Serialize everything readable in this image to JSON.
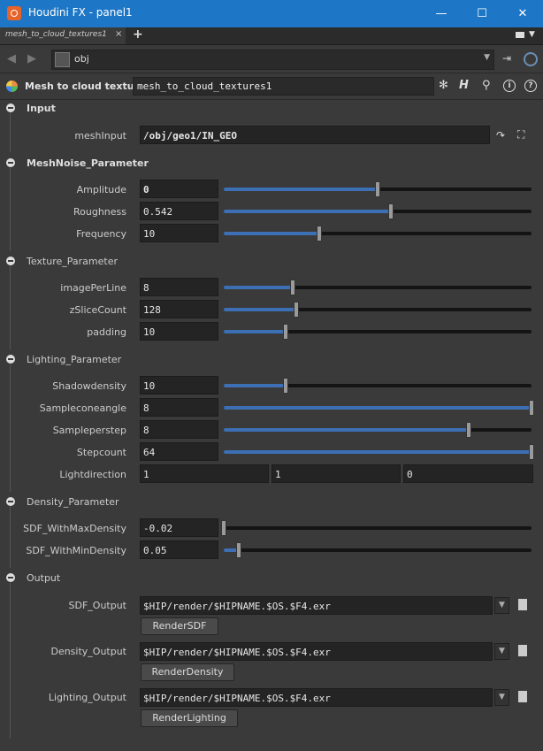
{
  "window": {
    "title": "Houdini FX - panel1",
    "minimize": "—",
    "maximize": "☐",
    "close": "✕"
  },
  "tabs": [
    {
      "label": "mesh_to_cloud_textures1",
      "close": "×"
    }
  ],
  "tab_add": "+",
  "path": {
    "value": "obj"
  },
  "operator": {
    "type_label": "Mesh to cloud textures",
    "name": "mesh_to_cloud_textures1"
  },
  "sections": {
    "input": "Input",
    "mesh_noise": "MeshNoise_Parameter",
    "texture": "Texture_Parameter",
    "lighting": "Lighting_Parameter",
    "density": "Density_Parameter",
    "output": "Output"
  },
  "params": {
    "meshInput": {
      "label": "meshInput",
      "value": "/obj/geo1/IN_GEO"
    },
    "amplitude": {
      "label": "Amplitude",
      "value": "0",
      "level": 0.5
    },
    "roughness": {
      "label": "Roughness",
      "value": "0.542",
      "level": 0.542
    },
    "frequency": {
      "label": "Frequency",
      "value": "10",
      "level": 0.31
    },
    "imagePerLine": {
      "label": "imagePerLine",
      "value": "8",
      "level": 0.225
    },
    "zSliceCount": {
      "label": "zSliceCount",
      "value": "128",
      "level": 0.235
    },
    "padding": {
      "label": "padding",
      "value": "10",
      "level": 0.2
    },
    "shadowdensity": {
      "label": "Shadowdensity",
      "value": "10",
      "level": 0.2
    },
    "sampleconeangle": {
      "label": "Sampleconeangle",
      "value": "8",
      "level": 1.0
    },
    "sampleperstep": {
      "label": "Sampleperstep",
      "value": "8",
      "level": 0.795
    },
    "stepcount": {
      "label": "Stepcount",
      "value": "64",
      "level": 1.0
    },
    "lightdirection": {
      "label": "Lightdirection",
      "values": [
        "1",
        "1",
        "0"
      ]
    },
    "sdfMax": {
      "label": "SDF_WithMaxDensity",
      "value": "-0.02",
      "level": 0.0
    },
    "sdfMin": {
      "label": "SDF_WithMinDensity",
      "value": "0.05",
      "level": 0.05
    },
    "sdfOutput": {
      "label": "SDF_Output",
      "value": "$HIP/render/$HIPNAME.$OS.$F4.exr",
      "button": "RenderSDF"
    },
    "densityOutput": {
      "label": "Density_Output",
      "value": "$HIP/render/$HIPNAME.$OS.$F4.exr",
      "button": "RenderDensity"
    },
    "lightingOutput": {
      "label": "Lighting_Output",
      "value": "$HIP/render/$HIPNAME.$OS.$F4.exr",
      "button": "RenderLighting"
    }
  },
  "colors": {
    "accent": "#1e77c6",
    "slider_fill": "#3d6fb5",
    "background": "#3a3a3a",
    "field": "#242424"
  }
}
